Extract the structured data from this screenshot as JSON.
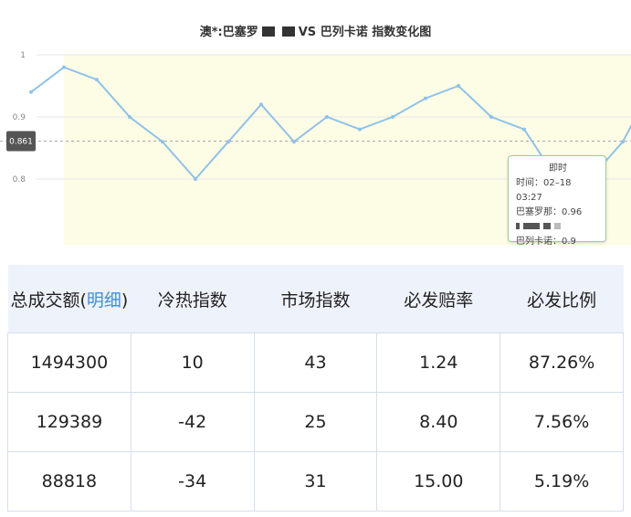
{
  "chart_data": {
    "type": "line",
    "title_left": "澳*:巴塞罗",
    "title_right": "VS 巴列卡诺 指数变化图",
    "ylim": [
      0.75,
      1.0
    ],
    "yticks": [
      "1",
      "0.9",
      "0.8"
    ],
    "ytick_values": [
      1.0,
      0.9,
      0.8
    ],
    "reference_value": 0.861,
    "reference_label": "0.861",
    "series": [
      {
        "values": [
          0.94,
          0.98,
          0.96,
          0.9,
          0.86,
          0.8,
          0.86,
          0.92,
          0.86,
          0.9,
          0.88,
          0.9,
          0.93,
          0.95,
          0.9,
          0.88,
          0.8,
          0.8,
          0.86,
          0.96
        ]
      }
    ],
    "colors": {
      "line": "#8ec2ea",
      "band": "#fdfde6",
      "reference": "#aaaaaa"
    }
  },
  "tooltip": {
    "header": "即时",
    "time": "时间：02–18 03:27",
    "home": "巴塞罗那：0.96",
    "away": "巴列卡诺：0.9"
  },
  "table": {
    "headers": {
      "total_prefix": "总成交额(",
      "total_link": "明细",
      "total_suffix": ")",
      "cold_hot": "冷热指数",
      "market": "市场指数",
      "odds": "必发赔率",
      "ratio": "必发比例"
    },
    "rows": [
      {
        "total": "1494300",
        "cold_hot": "10",
        "market": "43",
        "odds": "1.24",
        "ratio": "87.26%"
      },
      {
        "total": "129389",
        "cold_hot": "-42",
        "market": "25",
        "odds": "8.40",
        "ratio": "7.56%"
      },
      {
        "total": "88818",
        "cold_hot": "-34",
        "market": "31",
        "odds": "15.00",
        "ratio": "5.19%"
      }
    ]
  }
}
